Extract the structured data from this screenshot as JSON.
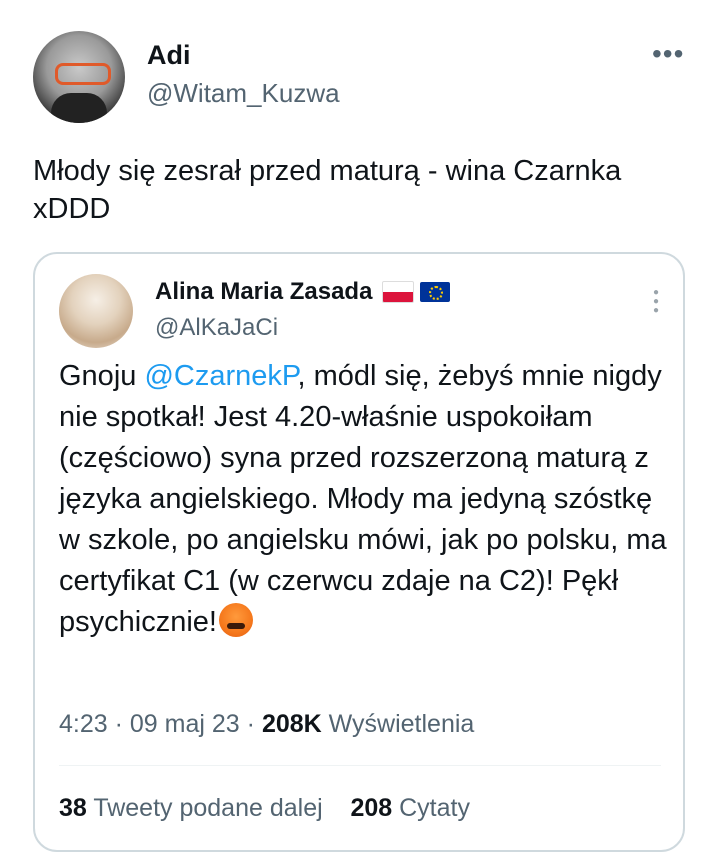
{
  "tweet": {
    "author_name": "Adi",
    "author_handle": "@Witam_Kuzwa",
    "text": "Młody się zesrał przed maturą - wina Czarnka xDDD",
    "more_icon": "more-horizontal-icon"
  },
  "quote": {
    "author_name": "Alina Maria Zasada",
    "author_handle": "@AlKaJaCi",
    "flags": [
      "poland-flag-icon",
      "eu-flag-icon"
    ],
    "text_before_mention": "Gnoju ",
    "mention": "@CzarnekP",
    "text_after_mention": ", módl się, żebyś mnie nigdy nie spotkał! Jest 4.20-właśnie uspokoiłam (częściowo) syna przed rozszerzoną maturą z języka angielskiego. Młody ma jedyną szóstkę w szkole, po angielsku mówi, jak po polsku, ma certyfikat C1 (w czerwcu zdaje na C2)! Pękł psychicznie!",
    "emoji": "angry-cursing-face-icon",
    "time": "4:23",
    "date": "09 maj 23",
    "views_count": "208K",
    "views_label": "Wyświetlenia",
    "retweets_count": "38",
    "retweets_label": "Tweety podane dalej",
    "quotes_count": "208",
    "quotes_label": "Cytaty",
    "more_icon": "more-vertical-icon"
  },
  "colors": {
    "text": "#0f1419",
    "secondary": "#536471",
    "link": "#1d9bf0",
    "border": "#cfd9de"
  }
}
